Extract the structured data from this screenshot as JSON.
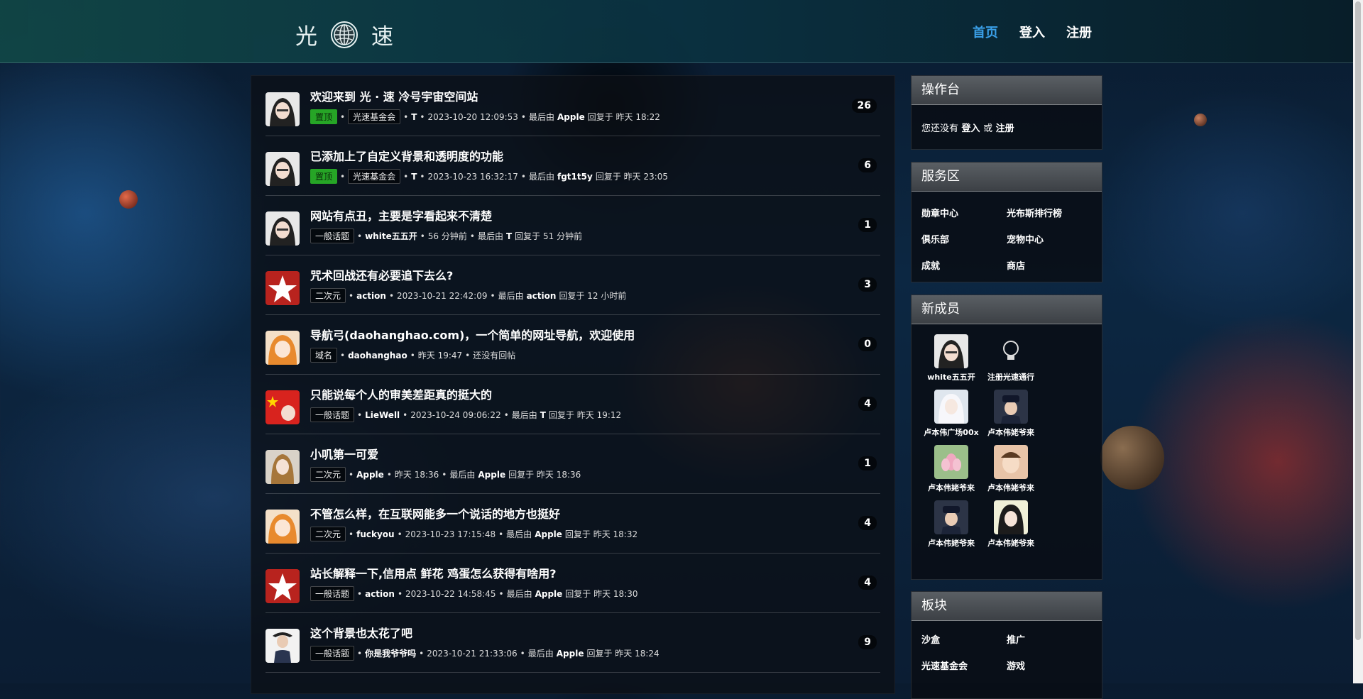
{
  "header": {
    "logo_left": "光",
    "logo_right": "速",
    "nav": [
      {
        "label": "首页",
        "active": true
      },
      {
        "label": "登入",
        "active": false
      },
      {
        "label": "注册",
        "active": false
      }
    ]
  },
  "topics": [
    {
      "title": "欢迎来到 光 · 速 冷号宇宙空间站",
      "pinned": "置顶",
      "tag": "光速基金会",
      "author": "T",
      "time": "2023-10-20 12:09:53",
      "last_prefix": "最后由",
      "last_user": "Apple",
      "last_suffix": "回复于 昨天 18:22",
      "count": "26",
      "avatar": "anime-girl"
    },
    {
      "title": "已添加上了自定义背景和透明度的功能",
      "pinned": "置顶",
      "tag": "光速基金会",
      "author": "T",
      "time": "2023-10-23 16:32:17",
      "last_prefix": "最后由",
      "last_user": "fgt1t5y",
      "last_suffix": "回复于 昨天 23:05",
      "count": "6",
      "avatar": "anime-girl"
    },
    {
      "title": "网站有点丑，主要是字看起来不清楚",
      "pinned": "",
      "tag": "一般话题",
      "author": "white五五开",
      "time": "56 分钟前",
      "last_prefix": "最后由",
      "last_user": "T",
      "last_suffix": "回复于 51 分钟前",
      "count": "1",
      "avatar": "anime-girl"
    },
    {
      "title": "咒术回战还有必要追下去么?",
      "pinned": "",
      "tag": "二次元",
      "author": "action",
      "time": "2023-10-21 22:42:09",
      "last_prefix": "最后由",
      "last_user": "action",
      "last_suffix": "回复于 12 小时前",
      "count": "3",
      "avatar": "red-star"
    },
    {
      "title": "导航弓(daohanghao.com)，一个简单的网址导航，欢迎使用",
      "pinned": "",
      "tag": "域名",
      "author": "daohanghao",
      "time": "昨天 19:47",
      "last_prefix": "",
      "last_user": "",
      "last_suffix": "还没有回帖",
      "count": "0",
      "avatar": "anime-orange"
    },
    {
      "title": "只能说每个人的审美差距真的挺大的",
      "pinned": "",
      "tag": "一般话题",
      "author": "LieWell",
      "time": "2023-10-24 09:06:22",
      "last_prefix": "最后由",
      "last_user": "T",
      "last_suffix": "回复于 昨天 19:12",
      "count": "4",
      "avatar": "red-flag"
    },
    {
      "title": "小叽第一可爱",
      "pinned": "",
      "tag": "二次元",
      "author": "Apple",
      "time": "昨天 18:36",
      "last_prefix": "最后由",
      "last_user": "Apple",
      "last_suffix": "回复于 昨天 18:36",
      "count": "1",
      "avatar": "blonde-girl"
    },
    {
      "title": "不管怎么样，在互联网能多一个说话的地方也挺好",
      "pinned": "",
      "tag": "二次元",
      "author": "fuckyou",
      "time": "2023-10-23 17:15:48",
      "last_prefix": "最后由",
      "last_user": "Apple",
      "last_suffix": "回复于 昨天 18:32",
      "count": "4",
      "avatar": "anime-orange"
    },
    {
      "title": "站长解释一下,信用点 鲜花 鸡蛋怎么获得有啥用?",
      "pinned": "",
      "tag": "一般话题",
      "author": "action",
      "time": "2023-10-22 14:58:45",
      "last_prefix": "最后由",
      "last_user": "Apple",
      "last_suffix": "回复于 昨天 18:30",
      "count": "4",
      "avatar": "red-star"
    },
    {
      "title": "这个背景也太花了吧",
      "pinned": "",
      "tag": "一般话题",
      "author": "你是我爷爷吗",
      "time": "2023-10-21 21:33:06",
      "last_prefix": "最后由",
      "last_user": "Apple",
      "last_suffix": "回复于 昨天 18:24",
      "count": "9",
      "avatar": "man-suit"
    }
  ],
  "sidebar": {
    "console": {
      "title": "操作台",
      "text_a": "您还没有",
      "login": "登入",
      "text_or": "或",
      "register": "注册"
    },
    "services": {
      "title": "服务区",
      "items": [
        "勋章中心",
        "光布斯排行榜",
        "俱乐部",
        "宠物中心",
        "成就",
        "商店"
      ]
    },
    "members": {
      "title": "新成员",
      "items": [
        {
          "name": "white五五开",
          "avatar": "anime-girl"
        },
        {
          "name": "注册光速通行",
          "avatar": "bulb"
        },
        {
          "name": "卢本伟广场00x",
          "avatar": "white-hair"
        },
        {
          "name": "卢本伟姥爷来",
          "avatar": "police"
        },
        {
          "name": "卢本伟姥爷来",
          "avatar": "lotus"
        },
        {
          "name": "卢本伟姥爷来",
          "avatar": "child"
        },
        {
          "name": "卢本伟姥爷来",
          "avatar": "police"
        },
        {
          "name": "卢本伟姥爷来",
          "avatar": "anime-dark"
        }
      ]
    },
    "boards": {
      "title": "板块",
      "items": [
        "沙盒",
        "推广",
        "光速基金会",
        "游戏"
      ]
    }
  },
  "colors": {
    "accent": "#3aa0e8",
    "pin": "#26a526"
  }
}
